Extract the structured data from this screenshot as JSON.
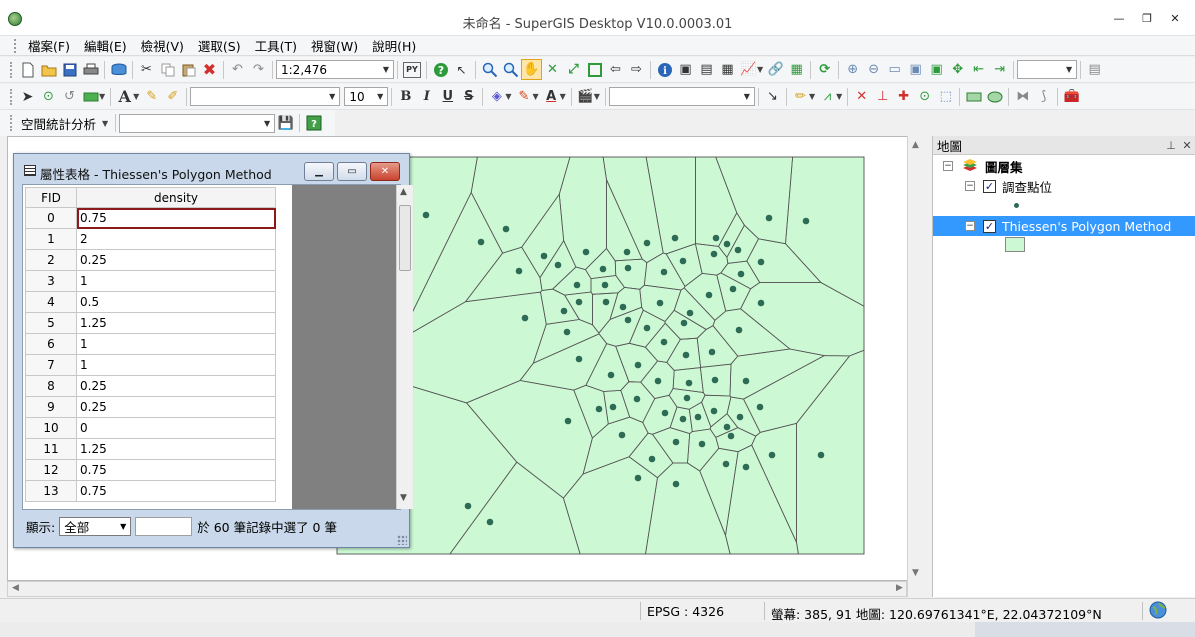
{
  "window": {
    "title": "未命名 - SuperGIS Desktop V10.0.0003.01",
    "minimize": "—",
    "restore": "❐",
    "close": "✕"
  },
  "menu": [
    "檔案(F)",
    "編輯(E)",
    "檢視(V)",
    "選取(S)",
    "工具(T)",
    "視窗(W)",
    "說明(H)"
  ],
  "toolbar": {
    "scale": "1:2,476",
    "font_size": "10",
    "bold": "B",
    "italic": "I",
    "underline": "U",
    "strike": "S",
    "spatial_stats_label": "空間統計分析"
  },
  "icons": {
    "new": "new-icon",
    "open": "open-icon",
    "save": "save-icon",
    "print": "print-icon",
    "cut": "cut-icon",
    "copy": "copy-icon",
    "paste": "paste-icon",
    "delete": "delete-icon",
    "undo": "undo-icon",
    "redo": "redo-icon",
    "python": "python-icon",
    "help": "help-icon",
    "zoom_in": "zoom-in-icon",
    "zoom_out": "zoom-out-icon",
    "pan": "pan-hand-icon",
    "identify": "identify-icon",
    "refresh": "refresh-icon"
  },
  "attribute_table": {
    "title": "屬性表格 - Thiessen's Polygon Method",
    "columns": [
      "FID",
      "density"
    ],
    "rows": [
      [
        "0",
        "0.75"
      ],
      [
        "1",
        "2"
      ],
      [
        "2",
        "0.25"
      ],
      [
        "3",
        "1"
      ],
      [
        "4",
        "0.5"
      ],
      [
        "5",
        "1.25"
      ],
      [
        "6",
        "1"
      ],
      [
        "7",
        "1"
      ],
      [
        "8",
        "0.25"
      ],
      [
        "9",
        "0.25"
      ],
      [
        "10",
        "0"
      ],
      [
        "11",
        "1.25"
      ],
      [
        "12",
        "0.75"
      ],
      [
        "13",
        "0.75"
      ]
    ],
    "show_label": "顯示:",
    "show_value": "全部",
    "record_summary": "於 60 筆記錄中選了 0 筆"
  },
  "map_panel": {
    "title": "地圖",
    "root_layer": "圖層集",
    "layers": [
      {
        "name": "調查點位",
        "checked": true
      },
      {
        "name": "Thiessen's Polygon Method",
        "checked": true
      }
    ]
  },
  "status": {
    "epsg": "EPSG : 4326",
    "coords": "螢幕: 385, 91  地圖: 120.69761341°E, 22.04372109°N"
  },
  "colors": {
    "polygon_fill": "#ccf8d4",
    "polygon_edge": "#555555",
    "point": "#2e6b55",
    "selection": "#3399ff"
  }
}
